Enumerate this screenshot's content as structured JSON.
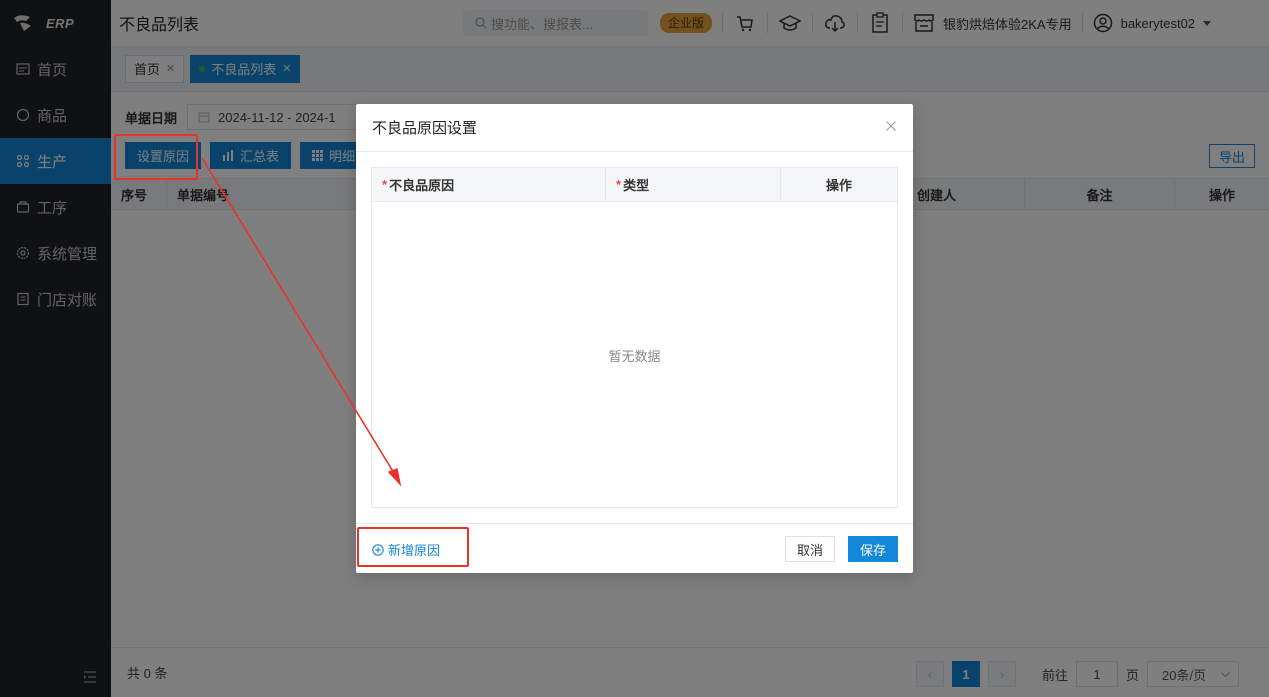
{
  "sidebar": {
    "logo_text": "ERP",
    "items": [
      {
        "label": "首页",
        "icon": "home-icon"
      },
      {
        "label": "商品",
        "icon": "goods-icon"
      },
      {
        "label": "生产",
        "icon": "production-icon",
        "active": true
      },
      {
        "label": "工序",
        "icon": "process-icon"
      },
      {
        "label": "系统管理",
        "icon": "gear-icon"
      },
      {
        "label": "门店对账",
        "icon": "reconcile-icon"
      }
    ]
  },
  "topbar": {
    "title": "不良品列表",
    "search_placeholder": "搜功能、搜报表...",
    "edition_badge": "企业版",
    "store_name": "银豹烘焙体验2KA专用",
    "username": "bakerytest02"
  },
  "tabs": [
    {
      "label": "首页",
      "active": false
    },
    {
      "label": "不良品列表",
      "active": true
    }
  ],
  "filter": {
    "label": "单据日期",
    "date_range": "2024-11-12  - 2024-1"
  },
  "toolbar": {
    "set_reason": "设置原因",
    "summary": "汇总表",
    "detail": "明细",
    "export": "导出"
  },
  "table": {
    "columns": [
      "序号",
      "单据编号",
      "创建人",
      "备注",
      "操作"
    ]
  },
  "footer": {
    "total": "共 0 条",
    "current_page": "1",
    "goto_label": "前往",
    "goto_value": "1",
    "page_unit": "页",
    "page_size": "20条/页"
  },
  "modal": {
    "title": "不良品原因设置",
    "columns": {
      "reason": "不良品原因",
      "type": "类型",
      "action": "操作"
    },
    "required_mark": "*",
    "empty_text": "暂无数据",
    "add_reason": "新增原因",
    "cancel": "取消",
    "save": "保存"
  },
  "colors": {
    "accent": "#1387d8",
    "sidebar_bg": "#202224",
    "annotation": "#e8332b",
    "edition_badge": "#e6a23c"
  }
}
